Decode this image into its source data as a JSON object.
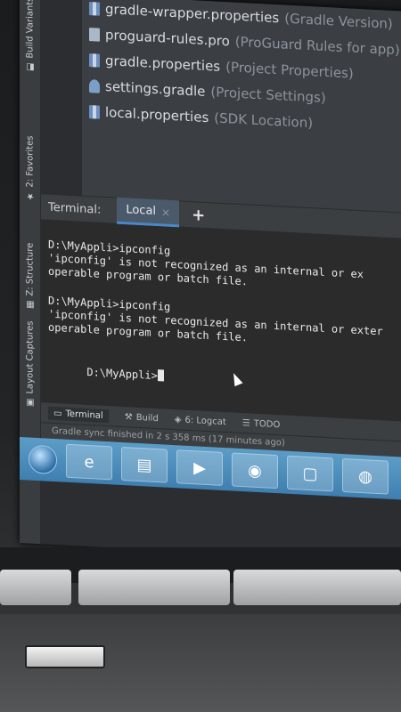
{
  "tool_strip": {
    "tabs": [
      {
        "label": "Build Variants",
        "icon": "build-variants-icon"
      },
      {
        "label": "2: Favorites",
        "icon": "star-icon"
      },
      {
        "label": "Z: Structure",
        "icon": "structure-icon"
      },
      {
        "label": "Layout Captures",
        "icon": "layout-captures-icon"
      }
    ]
  },
  "project_tree": {
    "items": [
      {
        "name": "gradle-wrapper.properties",
        "hint": "(Gradle Version)",
        "icon": "properties-file-icon"
      },
      {
        "name": "proguard-rules.pro",
        "hint": "(ProGuard Rules for app)",
        "icon": "file-icon"
      },
      {
        "name": "gradle.properties",
        "hint": "(Project Properties)",
        "icon": "properties-file-icon"
      },
      {
        "name": "settings.gradle",
        "hint": "(Project Settings)",
        "icon": "gradle-file-icon"
      },
      {
        "name": "local.properties",
        "hint": "(SDK Location)",
        "icon": "properties-file-icon"
      }
    ]
  },
  "terminal": {
    "title": "Terminal:",
    "tab_label": "Local",
    "close_glyph": "×",
    "add_glyph": "+",
    "lines": [
      "D:\\MyAppli>ipconfig",
      "'ipconfig' is not recognized as an internal or ex",
      "operable program or batch file.",
      "",
      "D:\\MyAppli>ipconfig",
      "'ipconfig' is not recognized as an internal or exter",
      "operable program or batch file.",
      ""
    ],
    "prompt": "D:\\MyAppli>"
  },
  "bottom_tabs": [
    {
      "label": "Terminal",
      "icon": "terminal-icon",
      "active": true
    },
    {
      "label": "Build",
      "icon": "hammer-icon",
      "active": false
    },
    {
      "label": "6: Logcat",
      "icon": "logcat-icon",
      "active": false
    },
    {
      "label": "TODO",
      "icon": "todo-icon",
      "active": false
    }
  ],
  "status_bar": {
    "text": "Gradle sync finished in 2 s 358 ms (17 minutes ago)"
  },
  "taskbar": {
    "buttons": [
      {
        "name": "internet-explorer",
        "glyph": "e"
      },
      {
        "name": "file-explorer",
        "glyph": "▤"
      },
      {
        "name": "media-player",
        "glyph": "▶"
      },
      {
        "name": "chrome",
        "glyph": "◉"
      },
      {
        "name": "window",
        "glyph": "▢"
      },
      {
        "name": "firefox",
        "glyph": "◍"
      }
    ]
  }
}
